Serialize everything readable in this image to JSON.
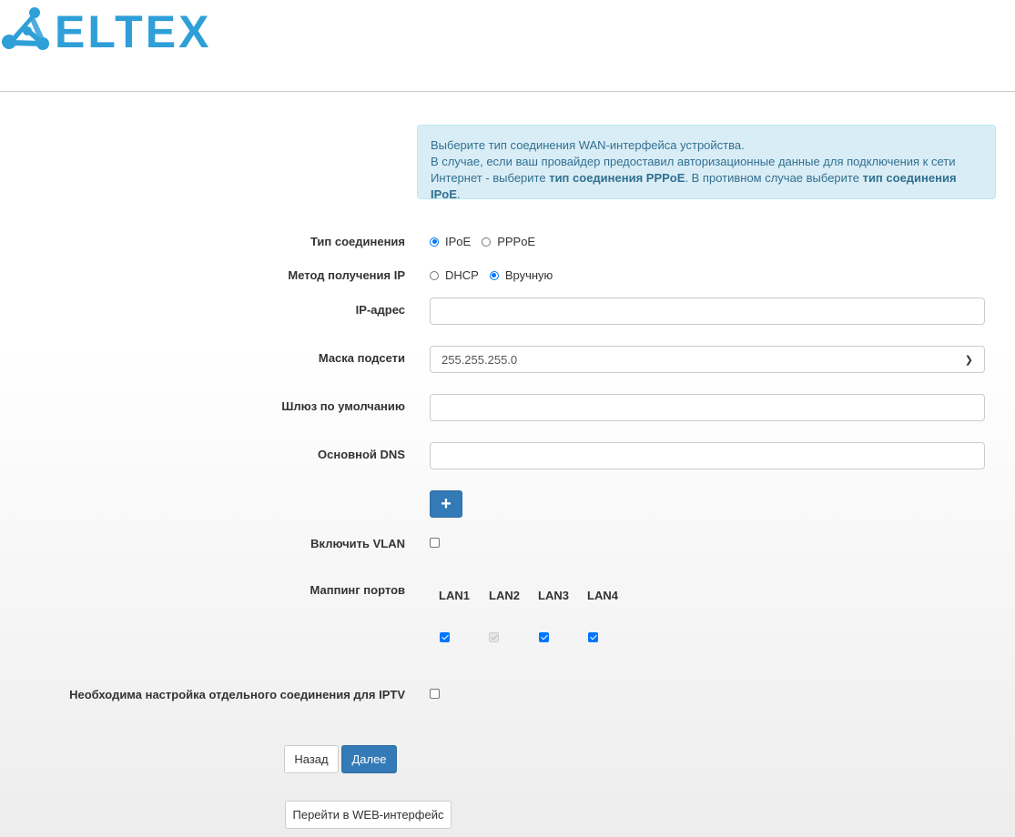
{
  "brand": {
    "name": "ELTEX",
    "color": "#2f9fd8"
  },
  "info": {
    "line1": "Выберите тип соединения WAN-интерфейса устройства.",
    "line2": "В случае, если ваш провайдер предоставил авторизационные данные для подключения к сети",
    "line3_pre": "Интернет - выберите ",
    "line3_b1": "тип соединения PPPoE",
    "line3_mid": ". В противном случае выберите ",
    "line3_b2": "тип соединения IPoE",
    "line3_post": "."
  },
  "form": {
    "connection_type": {
      "label": "Тип соединения",
      "options": [
        "IPoE",
        "PPPoE"
      ],
      "selected": "IPoE"
    },
    "ip_method": {
      "label": "Метод получения IP",
      "options": [
        "DHCP",
        "Вручную"
      ],
      "selected": "Вручную"
    },
    "ip_address": {
      "label": "IP-адрес",
      "value": ""
    },
    "subnet_mask": {
      "label": "Маска подсети",
      "value": "255.255.255.0"
    },
    "gateway": {
      "label": "Шлюз по умолчанию",
      "value": ""
    },
    "dns": {
      "label": "Основной DNS",
      "value": ""
    },
    "add_dns": {
      "icon": "plus-icon",
      "glyph": "+"
    },
    "vlan": {
      "label": "Включить VLAN",
      "checked": false
    },
    "port_mapping": {
      "label": "Маппинг портов",
      "ports": [
        {
          "name": "LAN1",
          "checked": true,
          "disabled": false
        },
        {
          "name": "LAN2",
          "checked": true,
          "disabled": true
        },
        {
          "name": "LAN3",
          "checked": true,
          "disabled": false
        },
        {
          "name": "LAN4",
          "checked": true,
          "disabled": false
        }
      ]
    },
    "iptv": {
      "label": "Необходима настройка отдельного соединения для IPTV",
      "checked": false
    }
  },
  "buttons": {
    "back": "Назад",
    "next": "Далее",
    "web": "Перейти в WEB-интерфейс"
  },
  "colors": {
    "primary": "#337ab7",
    "info_bg": "#d9edf7",
    "info_text": "#31708f"
  }
}
